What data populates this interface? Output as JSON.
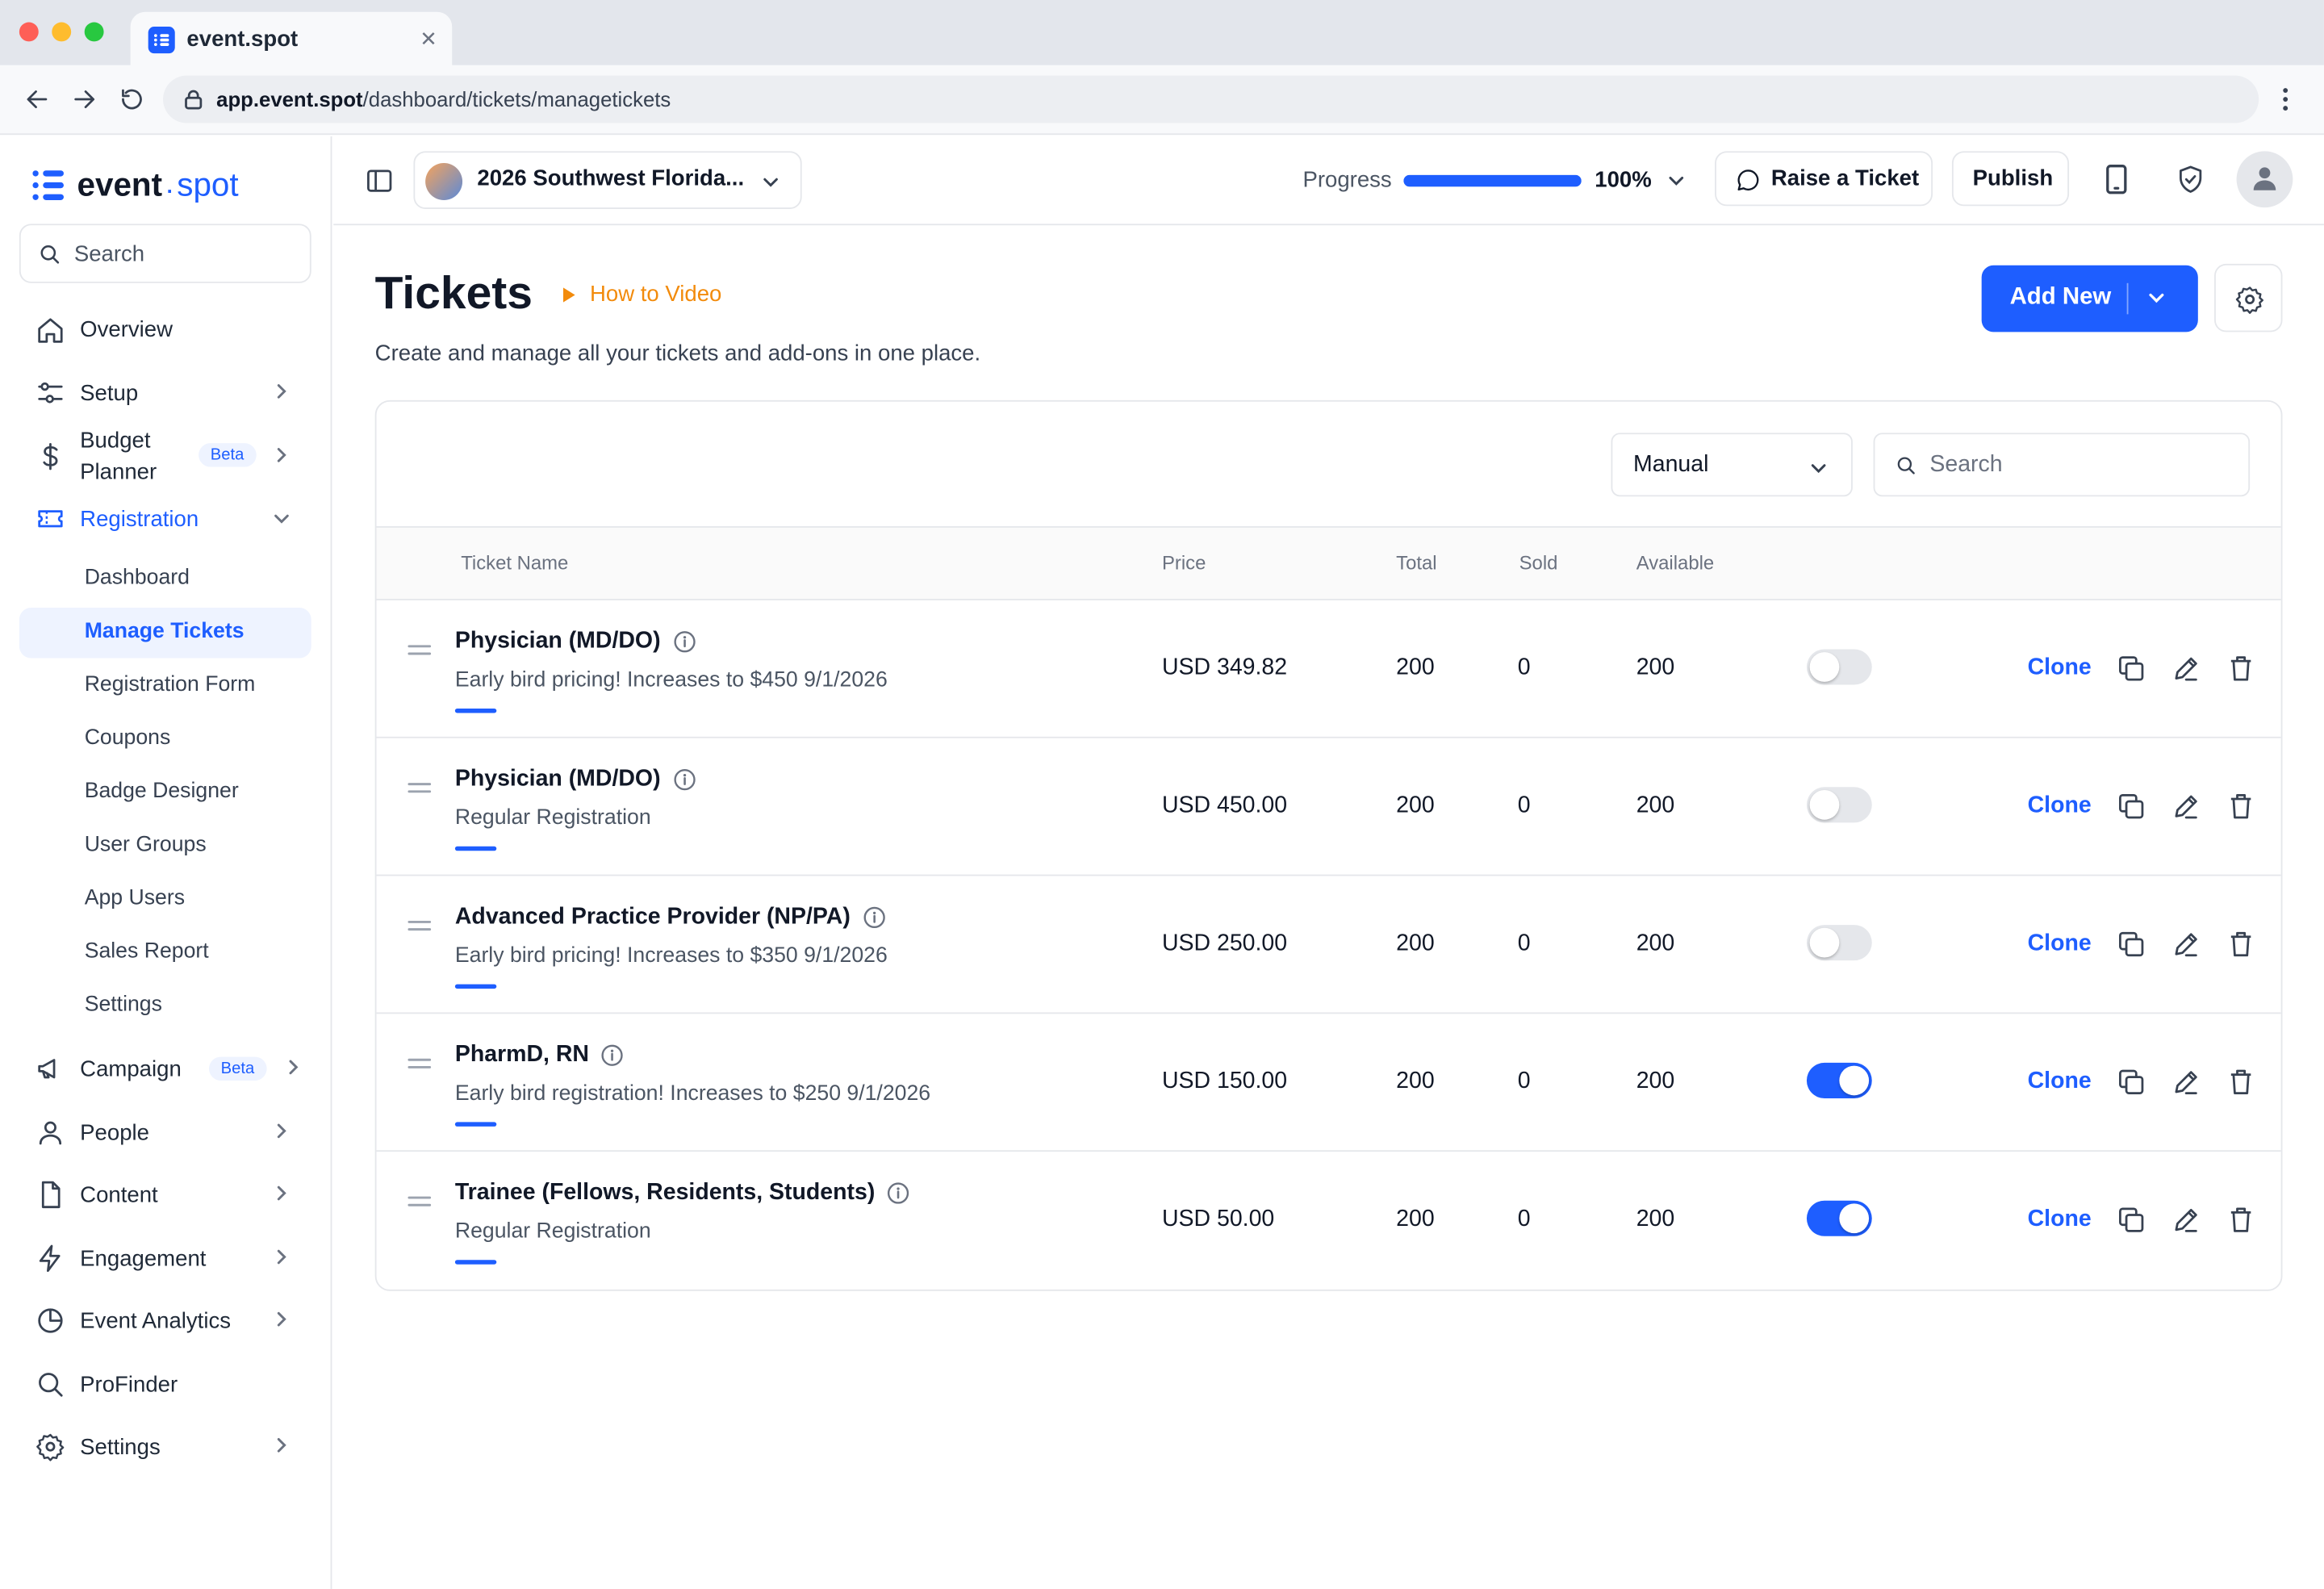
{
  "browser": {
    "tab_title": "event.spot",
    "url_host": "app.event.spot",
    "url_path": "/dashboard/tickets/managetickets"
  },
  "brand": {
    "name_part1": "event",
    "name_part2": "spot",
    "accent": "#1e5eff"
  },
  "sidebar": {
    "search_placeholder": "Search",
    "items": [
      {
        "label": "Overview",
        "icon": "home-icon"
      },
      {
        "label": "Setup",
        "icon": "sliders-icon"
      },
      {
        "label_line1": "Budget",
        "label_line2": "Planner",
        "badge": "Beta",
        "icon": "dollar-icon"
      },
      {
        "label": "Registration",
        "icon": "ticket-icon"
      },
      {
        "label": "Campaign",
        "badge": "Beta",
        "icon": "megaphone-icon"
      },
      {
        "label": "People",
        "icon": "user-icon"
      },
      {
        "label": "Content",
        "icon": "file-icon"
      },
      {
        "label": "Engagement",
        "icon": "lightning-icon"
      },
      {
        "label": "Event Analytics",
        "icon": "pie-chart-icon"
      },
      {
        "label": "ProFinder",
        "icon": "search-icon"
      },
      {
        "label": "Settings",
        "icon": "gear-icon"
      }
    ],
    "registration_sub": [
      "Dashboard",
      "Manage Tickets",
      "Registration Form",
      "Coupons",
      "Badge Designer",
      "User Groups",
      "App Users",
      "Sales Report",
      "Settings"
    ]
  },
  "header": {
    "event_name": "2026 Southwest Florida...",
    "progress_label": "Progress",
    "progress_value": 100,
    "progress_text": "100%",
    "raise_ticket": "Raise a Ticket",
    "publish": "Publish"
  },
  "page": {
    "title": "Tickets",
    "how_to": "How to Video",
    "description": "Create and manage all your tickets and add-ons in one place.",
    "add_new": "Add New"
  },
  "table": {
    "sort_value": "Manual",
    "search_placeholder": "Search",
    "columns": [
      "Ticket Name",
      "Price",
      "Total",
      "Sold",
      "Available"
    ],
    "clone_label": "Clone",
    "rows": [
      {
        "name": "Physician (MD/DO)",
        "desc": "Early bird pricing! Increases to $450 9/1/2026",
        "price": "USD 349.82",
        "total": "200",
        "sold": "0",
        "available": "200",
        "enabled": false
      },
      {
        "name": "Physician (MD/DO)",
        "desc": "Regular Registration",
        "price": "USD 450.00",
        "total": "200",
        "sold": "0",
        "available": "200",
        "enabled": false
      },
      {
        "name": "Advanced Practice Provider (NP/PA)",
        "desc": "Early bird pricing! Increases to $350 9/1/2026",
        "price": "USD 250.00",
        "total": "200",
        "sold": "0",
        "available": "200",
        "enabled": false
      },
      {
        "name": "PharmD, RN",
        "desc": "Early bird registration! Increases to $250 9/1/2026",
        "price": "USD 150.00",
        "total": "200",
        "sold": "0",
        "available": "200",
        "enabled": true
      },
      {
        "name": "Trainee (Fellows, Residents, Students)",
        "desc": "Regular Registration",
        "price": "USD 50.00",
        "total": "200",
        "sold": "0",
        "available": "200",
        "enabled": true
      }
    ]
  }
}
